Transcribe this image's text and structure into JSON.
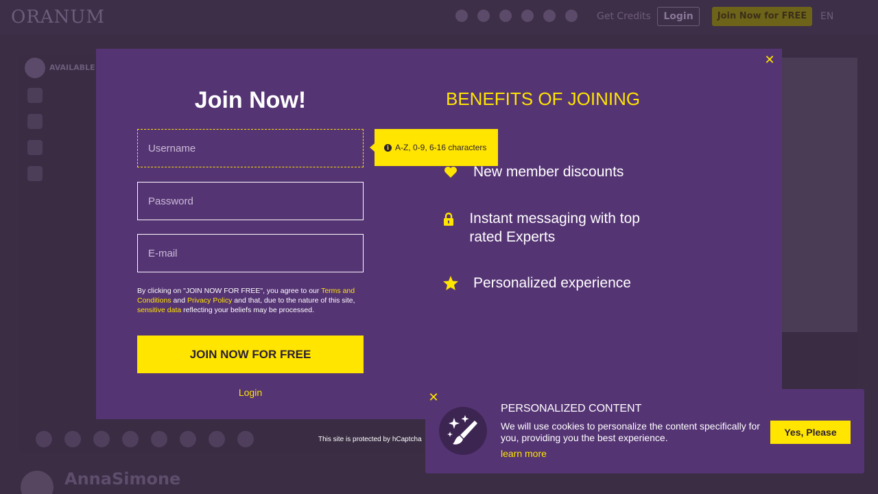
{
  "background": {
    "logo": "ORANUM",
    "header": {
      "credits_label": "Get Credits",
      "login_label": "Login",
      "join_label": "Join Now for FREE",
      "language": "EN"
    },
    "profile": {
      "status": "AVAILABLE",
      "name": "AnnaSimone"
    }
  },
  "modal": {
    "title": "Join Now!",
    "username_placeholder": "Username",
    "password_placeholder": "Password",
    "email_placeholder": "E-mail",
    "username_hint": "A-Z, 0-9, 6-16 characters",
    "terms": {
      "prefix": "By clicking on \"JOIN NOW FOR FREE\", you agree to our ",
      "terms_link": "Terms and Conditions",
      "and": " and ",
      "privacy_link": "Privacy Policy",
      "middle": " and that, due to the nature of this site, ",
      "sensitive_link": "sensitive data",
      "suffix": " reflecting your beliefs may be processed."
    },
    "join_button": "JOIN NOW FOR FREE",
    "login_link": "Login",
    "benefits_title": "BENEFITS OF JOINING",
    "benefits": [
      {
        "icon": "heart-icon",
        "text": "New member discounts"
      },
      {
        "icon": "lock-icon",
        "text": "Instant messaging with top rated Experts"
      },
      {
        "icon": "star-icon",
        "text": "Personalized experience"
      }
    ],
    "captcha_note": "This site is protected by hCaptcha"
  },
  "cookie_banner": {
    "title": "PERSONALIZED CONTENT",
    "text": "We will use cookies to personalize the content specifically for you, providing you the best experience.",
    "learn_more": "learn more",
    "accept_button": "Yes, Please"
  },
  "colors": {
    "accent": "#ffe500",
    "modal_bg": "#553474",
    "overlay_bg": "#3a2d44"
  }
}
